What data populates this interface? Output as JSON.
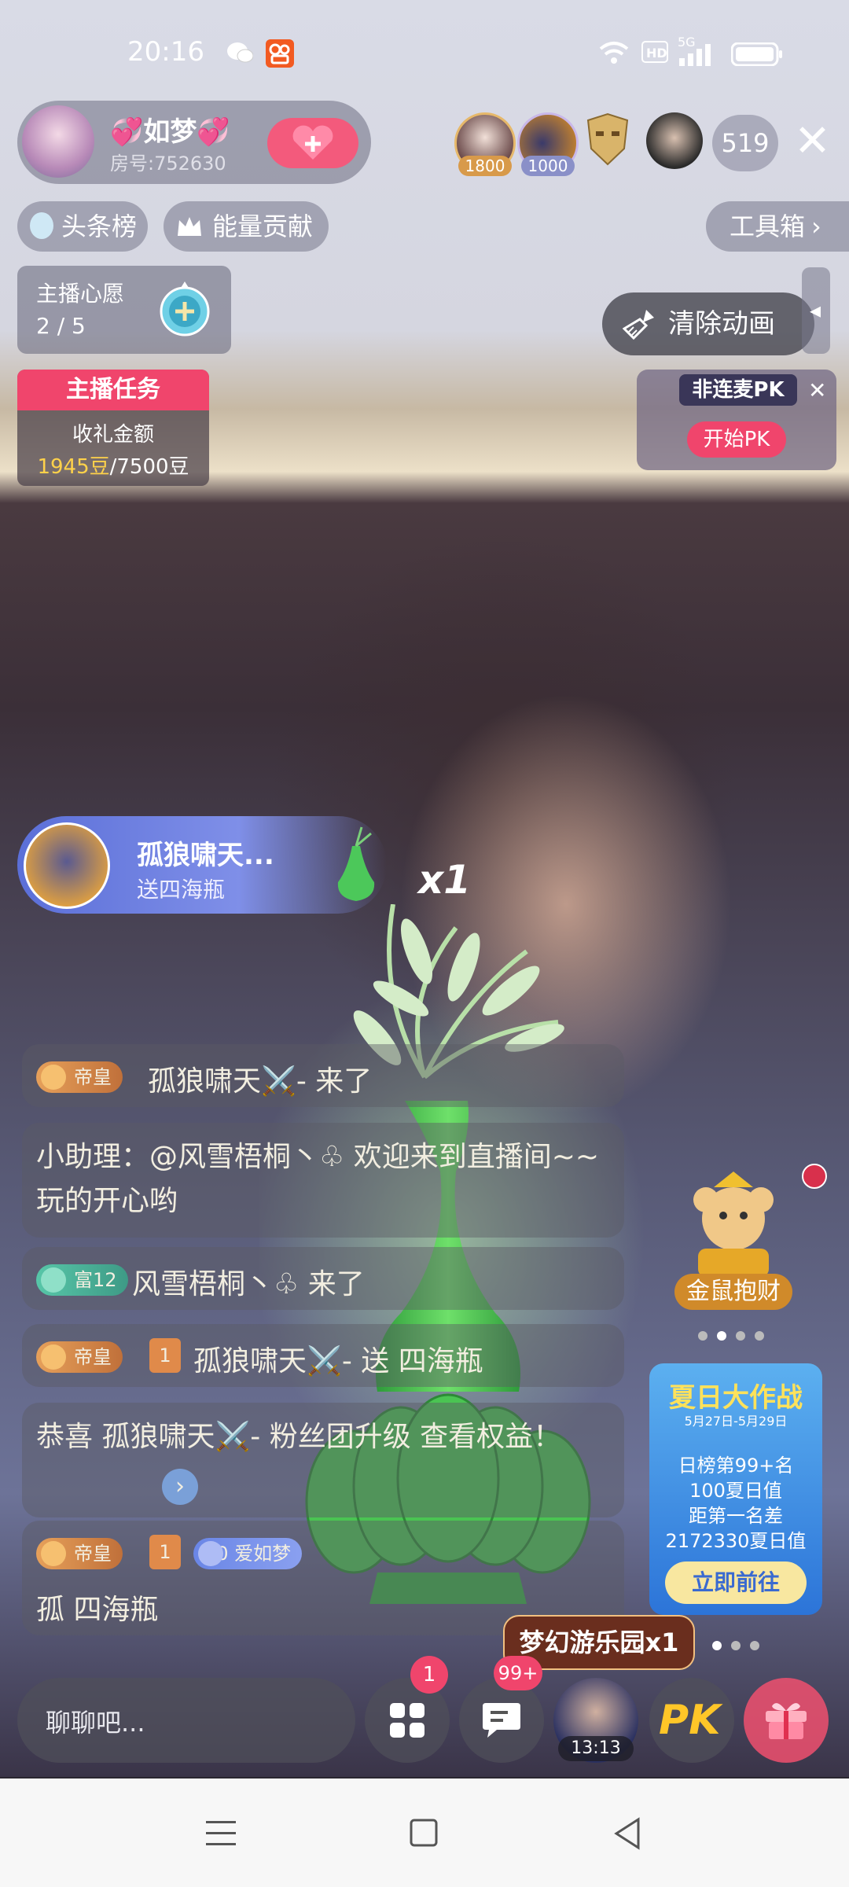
{
  "status_bar": {
    "time": "20:16",
    "network": "5G"
  },
  "host": {
    "name": "💞如梦💞",
    "room": "房号:752630"
  },
  "viewers": [
    {
      "badge": "1800"
    },
    {
      "badge": "1000"
    },
    {
      "badge": ""
    },
    {
      "badge": ""
    }
  ],
  "viewer_count": "519",
  "tags": {
    "headline": "头条榜",
    "energy": "能量贡献",
    "toolbox": "工具箱"
  },
  "wish": {
    "title": "主播心愿",
    "progress": "2 / 5"
  },
  "task": {
    "title": "主播任务",
    "label": "收礼金额",
    "current": "1945豆",
    "target": "/7500豆"
  },
  "clear_animation": "清除动画",
  "pk": {
    "title": "非连麦PK",
    "button": "开始PK"
  },
  "gift_banner": {
    "user": "孤狼啸天...",
    "action": "送四海瓶",
    "multiplier": "x1"
  },
  "chat": [
    {
      "badge": "帝皇",
      "text": "孤狼啸天⚔️- 来了"
    },
    {
      "text": "小助理：@风雪梧桐丶♧ 欢迎来到直播间~~ 玩的开心哟"
    },
    {
      "badge": "富12",
      "text": "风雪梧桐丶♧ 来了"
    },
    {
      "badge": "帝皇",
      "rank": "1",
      "text": "孤狼啸天⚔️- 送 四海瓶"
    },
    {
      "text": "恭喜 孤狼啸天⚔️- 粉丝团升级 查看权益！"
    },
    {
      "badge": "帝皇",
      "rank": "1",
      "fan": "10 爱如梦",
      "text": "孤 四海瓶"
    }
  ],
  "lucky": {
    "label": "金鼠抱财"
  },
  "summer": {
    "title": "夏日大作战",
    "dates": "5月27日-5月29日",
    "rank": "日榜第99+名",
    "value": "100夏日值",
    "gap_label": "距第一名差",
    "gap": "2172330夏日值",
    "button": "立即前往"
  },
  "park_badge": "梦幻游乐园x1",
  "bottom": {
    "chat_placeholder": "聊聊吧...",
    "apps_badge": "1",
    "msg_badge": "99+",
    "timer": "13:13",
    "pk": "PK"
  }
}
